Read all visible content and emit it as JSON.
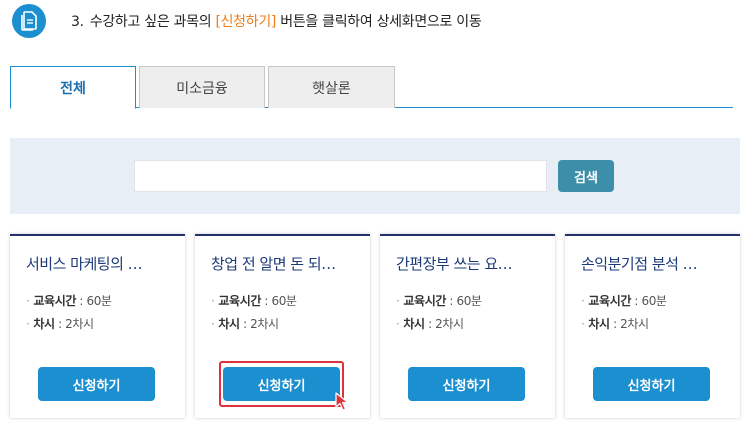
{
  "instruction": {
    "step_number": "3.",
    "prefix": "수강하고 싶은 과목의 ",
    "highlight": "[신청하기]",
    "suffix": " 버튼을 클릭하여 상세화면으로 이동"
  },
  "tabs": [
    {
      "label": "전체",
      "active": true
    },
    {
      "label": "미소금융",
      "active": false
    },
    {
      "label": "햇살론",
      "active": false
    }
  ],
  "search": {
    "value": "",
    "button_label": "검색"
  },
  "courses": [
    {
      "title": "서비스 마케팅의 …",
      "time_label": "교육시간",
      "time_value": " : 60분",
      "count_label": "차시",
      "count_value": " : 2차시",
      "button_label": "신청하기"
    },
    {
      "title": "창업 전 알면 돈 되…",
      "time_label": "교육시간",
      "time_value": " : 60분",
      "count_label": "차시",
      "count_value": " : 2차시",
      "button_label": "신청하기"
    },
    {
      "title": "간편장부 쓰는 요…",
      "time_label": "교육시간",
      "time_value": " : 60분",
      "count_label": "차시",
      "count_value": " : 2차시",
      "button_label": "신청하기"
    },
    {
      "title": "손익분기점 분석 …",
      "time_label": "교육시간",
      "time_value": " : 60분",
      "count_label": "차시",
      "count_value": " : 2차시",
      "button_label": "신청하기"
    }
  ],
  "colors": {
    "accent": "#1b8fd0",
    "highlight_text": "#f07d1a",
    "card_border_top": "#25316b",
    "search_button": "#3d8ea8",
    "click_indicator": "#e0313a"
  },
  "icons": {
    "step_icon": "document-icon",
    "cursor": "mouse-pointer-icon"
  }
}
